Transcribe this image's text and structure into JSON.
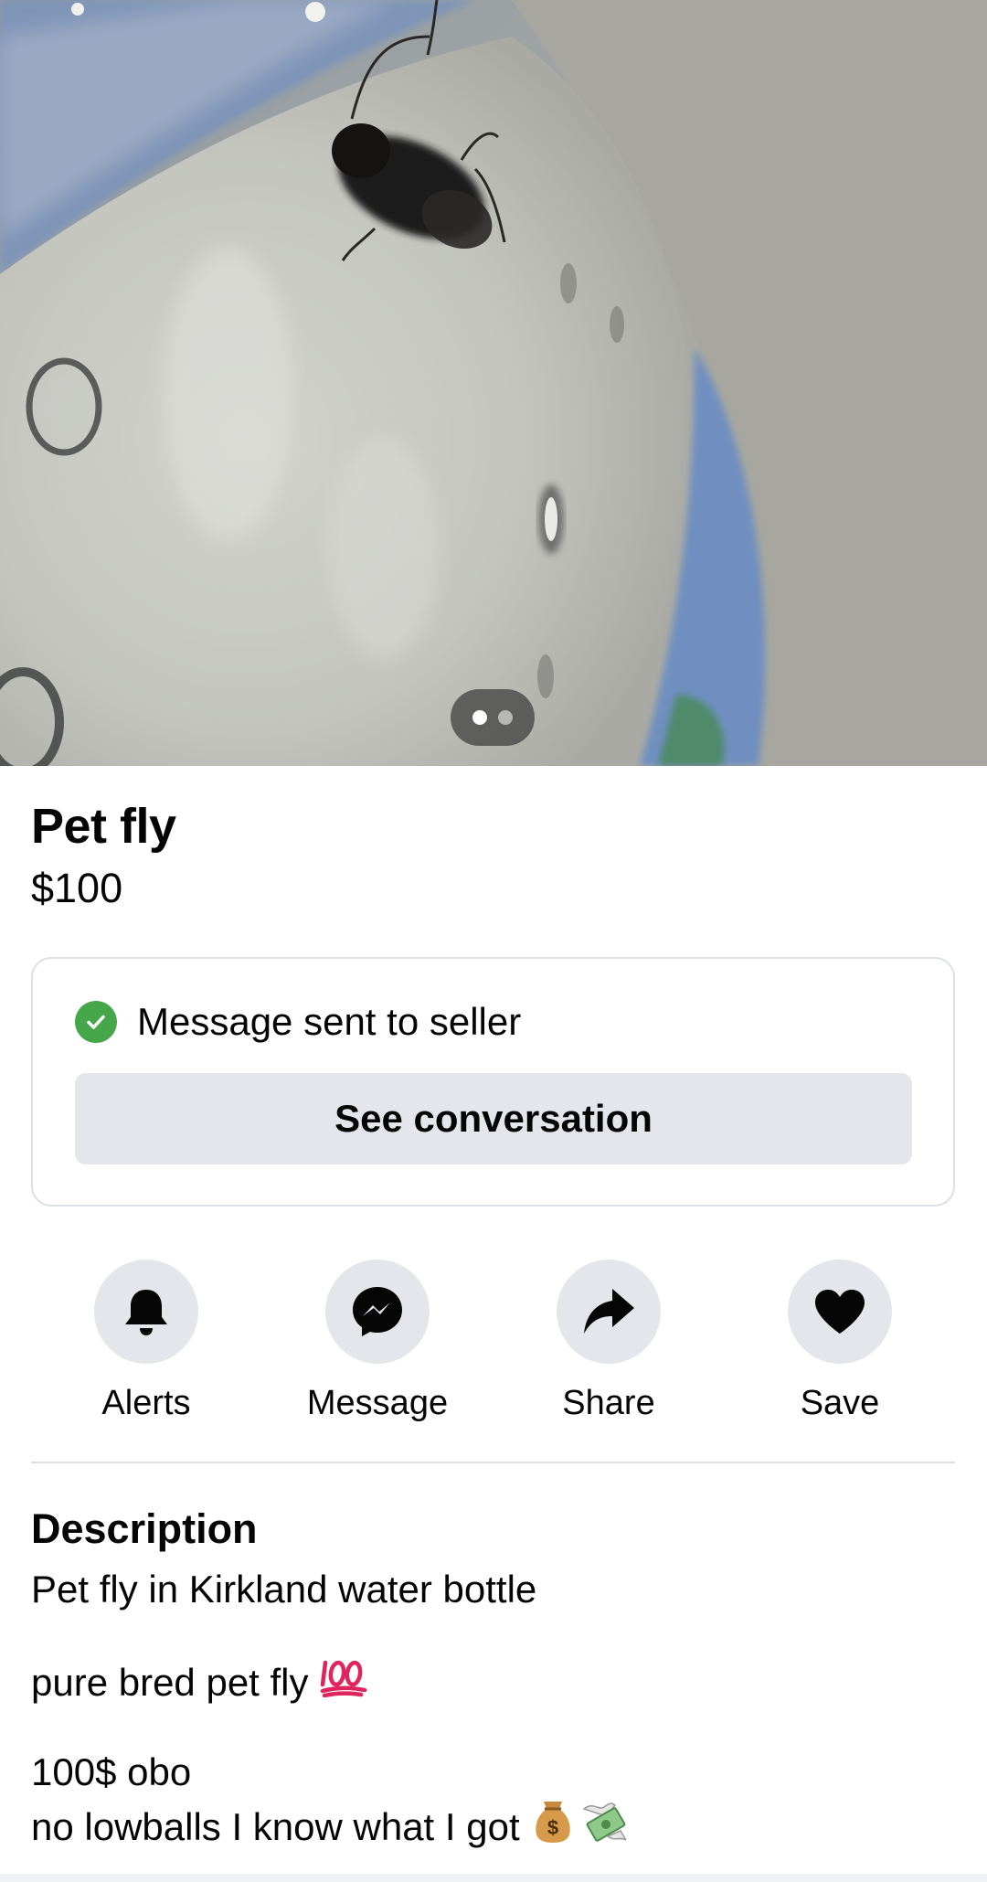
{
  "listing": {
    "title": "Pet fly",
    "price": "$100",
    "photo_count": 2,
    "photo_active_index": 1
  },
  "message_card": {
    "status_text": "Message sent to seller",
    "button_label": "See conversation"
  },
  "actions": [
    {
      "label": "Alerts",
      "icon": "bell-icon"
    },
    {
      "label": "Message",
      "icon": "messenger-icon"
    },
    {
      "label": "Share",
      "icon": "share-icon"
    },
    {
      "label": "Save",
      "icon": "heart-icon"
    }
  ],
  "description": {
    "heading": "Description",
    "line1": "Pet fly in Kirkland water bottle",
    "line2": "pure bred pet fly",
    "line2_emoji": "hundred-points-icon",
    "line3": "100$ obo",
    "line4": "no lowballs I know what I got",
    "line4_emojis": [
      "money-bag-icon",
      "money-with-wings-icon"
    ]
  },
  "colors": {
    "success_green": "#45a64a",
    "button_gray": "#e4e6eb",
    "text": "#050505"
  }
}
